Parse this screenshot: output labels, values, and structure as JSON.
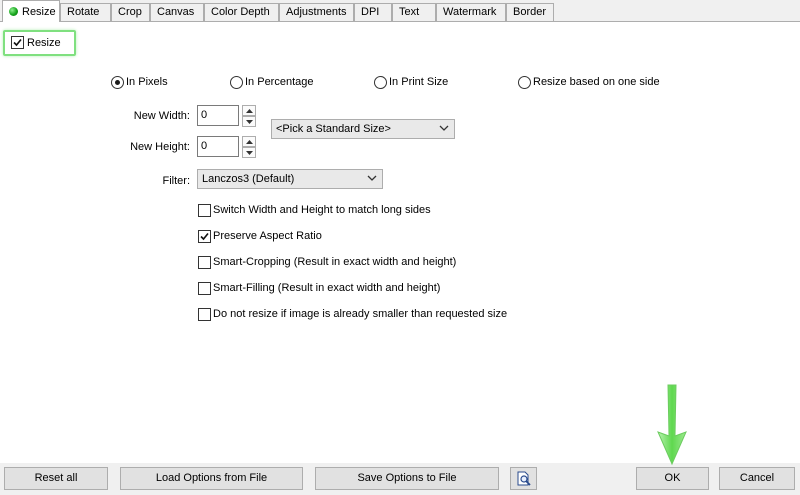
{
  "tabs": [
    "Resize",
    "Rotate",
    "Crop",
    "Canvas",
    "Color Depth",
    "Adjustments",
    "DPI",
    "Text",
    "Watermark",
    "Border"
  ],
  "resize_checkbox": {
    "label": "Resize",
    "checked": true
  },
  "radios": {
    "in_pixels": {
      "label": "In Pixels",
      "selected": true
    },
    "in_percentage": {
      "label": "In Percentage",
      "selected": false
    },
    "in_print_size": {
      "label": "In Print Size",
      "selected": false
    },
    "one_side": {
      "label": "Resize based on one side",
      "selected": false
    }
  },
  "new_width": {
    "label": "New Width:",
    "value": "0"
  },
  "new_height": {
    "label": "New Height:",
    "value": "0"
  },
  "standard_size": {
    "selected": "<Pick a Standard Size>"
  },
  "filter": {
    "label": "Filter:",
    "selected": "Lanczos3 (Default)"
  },
  "options": [
    {
      "label": "Switch Width and Height to match long sides",
      "checked": false
    },
    {
      "label": "Preserve Aspect Ratio",
      "checked": true
    },
    {
      "label": "Smart-Cropping (Result in exact width and height)",
      "checked": false
    },
    {
      "label": "Smart-Filling (Result in exact width and height)",
      "checked": false
    },
    {
      "label": "Do not resize if image is already smaller than requested size",
      "checked": false
    }
  ],
  "buttons": {
    "reset_all": "Reset all",
    "load_options": "Load Options from File",
    "save_options": "Save Options to File",
    "ok": "OK",
    "cancel": "Cancel"
  },
  "icons": {
    "active_tab": "green-dot-icon",
    "preview": "magnifier-document-icon",
    "highlight": "green-down-arrow-icon"
  },
  "colors": {
    "highlight": "#7fe07f",
    "tab_dot": "#17a51d"
  }
}
